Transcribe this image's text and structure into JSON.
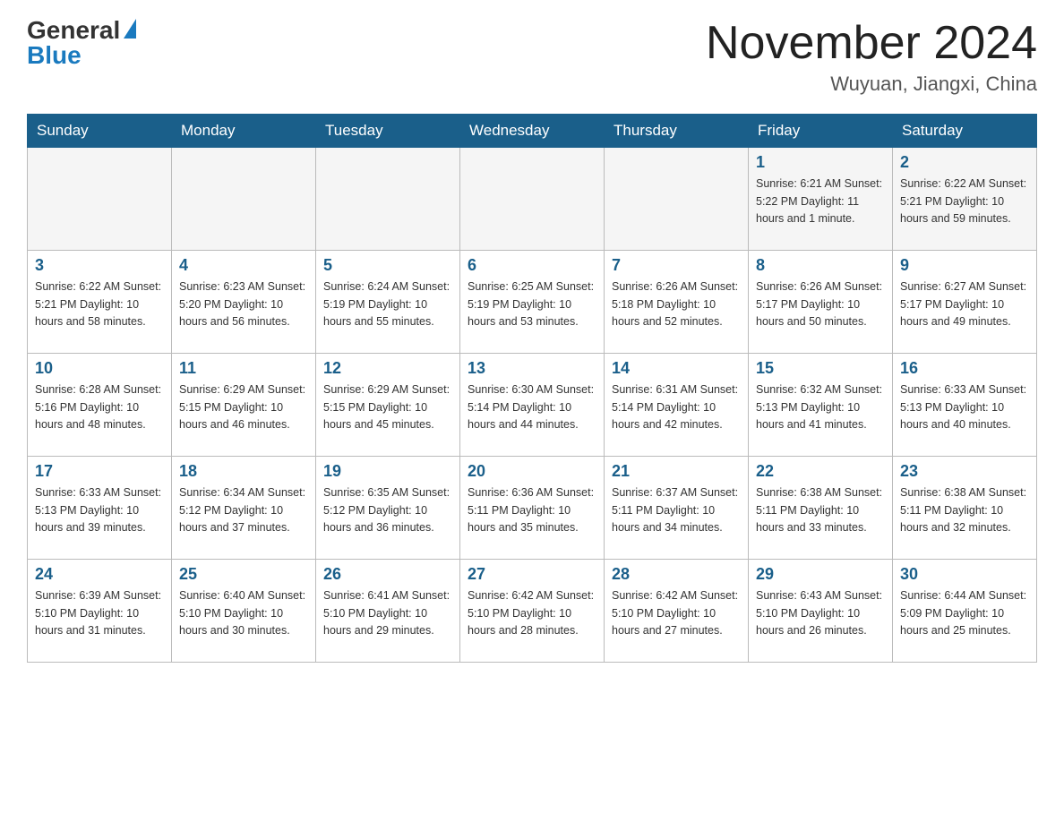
{
  "header": {
    "logo_general": "General",
    "logo_blue": "Blue",
    "month_title": "November 2024",
    "location": "Wuyuan, Jiangxi, China"
  },
  "days_of_week": [
    "Sunday",
    "Monday",
    "Tuesday",
    "Wednesday",
    "Thursday",
    "Friday",
    "Saturday"
  ],
  "weeks": [
    [
      {
        "day": "",
        "info": ""
      },
      {
        "day": "",
        "info": ""
      },
      {
        "day": "",
        "info": ""
      },
      {
        "day": "",
        "info": ""
      },
      {
        "day": "",
        "info": ""
      },
      {
        "day": "1",
        "info": "Sunrise: 6:21 AM\nSunset: 5:22 PM\nDaylight: 11 hours\nand 1 minute."
      },
      {
        "day": "2",
        "info": "Sunrise: 6:22 AM\nSunset: 5:21 PM\nDaylight: 10 hours\nand 59 minutes."
      }
    ],
    [
      {
        "day": "3",
        "info": "Sunrise: 6:22 AM\nSunset: 5:21 PM\nDaylight: 10 hours\nand 58 minutes."
      },
      {
        "day": "4",
        "info": "Sunrise: 6:23 AM\nSunset: 5:20 PM\nDaylight: 10 hours\nand 56 minutes."
      },
      {
        "day": "5",
        "info": "Sunrise: 6:24 AM\nSunset: 5:19 PM\nDaylight: 10 hours\nand 55 minutes."
      },
      {
        "day": "6",
        "info": "Sunrise: 6:25 AM\nSunset: 5:19 PM\nDaylight: 10 hours\nand 53 minutes."
      },
      {
        "day": "7",
        "info": "Sunrise: 6:26 AM\nSunset: 5:18 PM\nDaylight: 10 hours\nand 52 minutes."
      },
      {
        "day": "8",
        "info": "Sunrise: 6:26 AM\nSunset: 5:17 PM\nDaylight: 10 hours\nand 50 minutes."
      },
      {
        "day": "9",
        "info": "Sunrise: 6:27 AM\nSunset: 5:17 PM\nDaylight: 10 hours\nand 49 minutes."
      }
    ],
    [
      {
        "day": "10",
        "info": "Sunrise: 6:28 AM\nSunset: 5:16 PM\nDaylight: 10 hours\nand 48 minutes."
      },
      {
        "day": "11",
        "info": "Sunrise: 6:29 AM\nSunset: 5:15 PM\nDaylight: 10 hours\nand 46 minutes."
      },
      {
        "day": "12",
        "info": "Sunrise: 6:29 AM\nSunset: 5:15 PM\nDaylight: 10 hours\nand 45 minutes."
      },
      {
        "day": "13",
        "info": "Sunrise: 6:30 AM\nSunset: 5:14 PM\nDaylight: 10 hours\nand 44 minutes."
      },
      {
        "day": "14",
        "info": "Sunrise: 6:31 AM\nSunset: 5:14 PM\nDaylight: 10 hours\nand 42 minutes."
      },
      {
        "day": "15",
        "info": "Sunrise: 6:32 AM\nSunset: 5:13 PM\nDaylight: 10 hours\nand 41 minutes."
      },
      {
        "day": "16",
        "info": "Sunrise: 6:33 AM\nSunset: 5:13 PM\nDaylight: 10 hours\nand 40 minutes."
      }
    ],
    [
      {
        "day": "17",
        "info": "Sunrise: 6:33 AM\nSunset: 5:13 PM\nDaylight: 10 hours\nand 39 minutes."
      },
      {
        "day": "18",
        "info": "Sunrise: 6:34 AM\nSunset: 5:12 PM\nDaylight: 10 hours\nand 37 minutes."
      },
      {
        "day": "19",
        "info": "Sunrise: 6:35 AM\nSunset: 5:12 PM\nDaylight: 10 hours\nand 36 minutes."
      },
      {
        "day": "20",
        "info": "Sunrise: 6:36 AM\nSunset: 5:11 PM\nDaylight: 10 hours\nand 35 minutes."
      },
      {
        "day": "21",
        "info": "Sunrise: 6:37 AM\nSunset: 5:11 PM\nDaylight: 10 hours\nand 34 minutes."
      },
      {
        "day": "22",
        "info": "Sunrise: 6:38 AM\nSunset: 5:11 PM\nDaylight: 10 hours\nand 33 minutes."
      },
      {
        "day": "23",
        "info": "Sunrise: 6:38 AM\nSunset: 5:11 PM\nDaylight: 10 hours\nand 32 minutes."
      }
    ],
    [
      {
        "day": "24",
        "info": "Sunrise: 6:39 AM\nSunset: 5:10 PM\nDaylight: 10 hours\nand 31 minutes."
      },
      {
        "day": "25",
        "info": "Sunrise: 6:40 AM\nSunset: 5:10 PM\nDaylight: 10 hours\nand 30 minutes."
      },
      {
        "day": "26",
        "info": "Sunrise: 6:41 AM\nSunset: 5:10 PM\nDaylight: 10 hours\nand 29 minutes."
      },
      {
        "day": "27",
        "info": "Sunrise: 6:42 AM\nSunset: 5:10 PM\nDaylight: 10 hours\nand 28 minutes."
      },
      {
        "day": "28",
        "info": "Sunrise: 6:42 AM\nSunset: 5:10 PM\nDaylight: 10 hours\nand 27 minutes."
      },
      {
        "day": "29",
        "info": "Sunrise: 6:43 AM\nSunset: 5:10 PM\nDaylight: 10 hours\nand 26 minutes."
      },
      {
        "day": "30",
        "info": "Sunrise: 6:44 AM\nSunset: 5:09 PM\nDaylight: 10 hours\nand 25 minutes."
      }
    ]
  ]
}
